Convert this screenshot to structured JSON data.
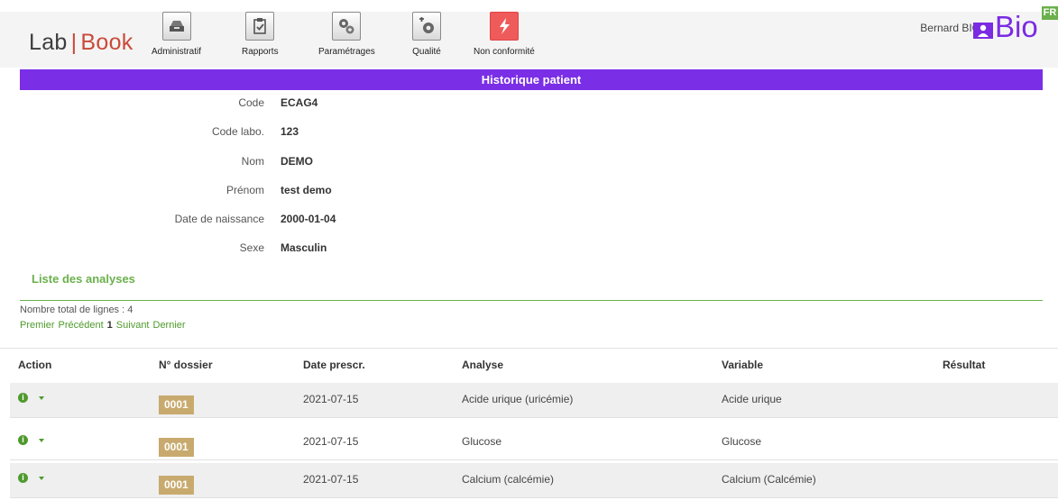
{
  "header": {
    "logo_left": "Lab",
    "logo_sep": "|",
    "logo_right": "Book",
    "nav": [
      {
        "label": "Administratif",
        "icon": "inbox-tray-icon"
      },
      {
        "label": "Rapports",
        "icon": "clipboard-check-icon"
      },
      {
        "label": "Paramétrages",
        "icon": "gears-icon"
      },
      {
        "label": "Qualité",
        "icon": "quality-gear-icon"
      },
      {
        "label": "Non conformité",
        "icon": "lightning-icon"
      }
    ],
    "user": "Bernard BIO",
    "brand": "Bio",
    "lang": "FR"
  },
  "page_title": "Historique patient",
  "patient": [
    {
      "label": "Code",
      "value": "ECAG4"
    },
    {
      "label": "Code labo.",
      "value": "123"
    },
    {
      "label": "Nom",
      "value": "DEMO"
    },
    {
      "label": "Prénom",
      "value": "test demo"
    },
    {
      "label": "Date de naissance",
      "value": "2000-01-04"
    },
    {
      "label": "Sexe",
      "value": "Masculin"
    }
  ],
  "analyses": {
    "title": "Liste des analyses",
    "count": "Nombre total de lignes : 4",
    "pager": {
      "first": "Premier",
      "prev": "Précédent",
      "current": "1",
      "next": "Suivant",
      "last": "Dernier"
    },
    "columns": [
      "Action",
      "N° dossier",
      "Date prescr.",
      "Analyse",
      "Variable",
      "Résultat"
    ],
    "rows": [
      {
        "dossier": "0001",
        "date": "2021-07-15",
        "analyse": "Acide urique (uricémie)",
        "variable": "Acide urique",
        "resultat": ""
      },
      {
        "dossier": "0001",
        "date": "2021-07-15",
        "analyse": "Glucose",
        "variable": "Glucose",
        "resultat": ""
      },
      {
        "dossier": "0001",
        "date": "2021-07-15",
        "analyse": "Calcium (calcémie)",
        "variable": "Calcium (Calcémie)",
        "resultat": ""
      }
    ]
  },
  "colors": {
    "accent_purple": "#7a2ee6",
    "accent_green": "#6ab04c",
    "badge_tan": "#c8aa6e"
  }
}
